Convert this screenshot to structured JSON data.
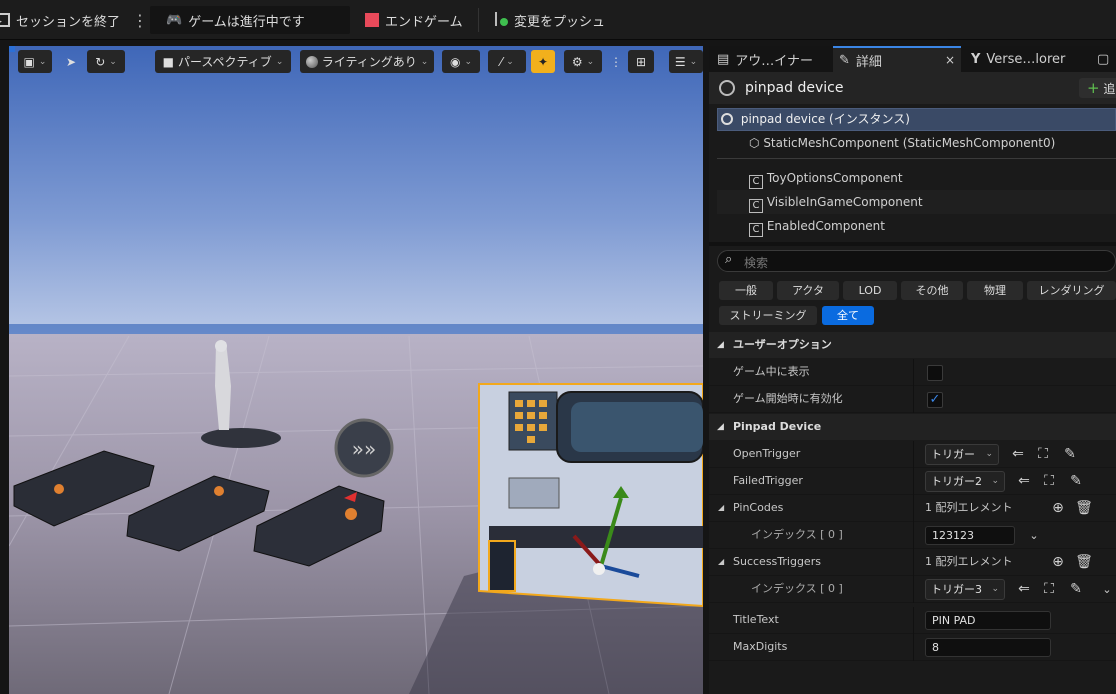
{
  "topbar": {
    "end_session": "セッションを終了",
    "game_running": "ゲームは進行中です",
    "end_game": "エンドゲーム",
    "push_changes": "変更をプッシュ"
  },
  "viewport": {
    "perspective": "パースペクティブ",
    "lighting": "ライティングあり"
  },
  "panel": {
    "tabs": [
      "アウ…イナー",
      "詳細",
      "Verse…lorer"
    ],
    "actor_name": "pinpad device",
    "add_label": "追",
    "instance_label": "pinpad device (インスタンス)",
    "components": [
      "StaticMeshComponent (StaticMeshComponent0)",
      "ToyOptionsComponent",
      "VisibleInGameComponent",
      "EnabledComponent"
    ],
    "search_placeholder": "検索",
    "filters": [
      "一般",
      "アクタ",
      "LOD",
      "その他",
      "物理",
      "レンダリング",
      "ストリーミング",
      "全て"
    ],
    "sections": {
      "user_options": "ユーザーオプション",
      "pinpad": "Pinpad Device"
    },
    "props": {
      "show_in_game": "ゲーム中に表示",
      "enable_at_start": "ゲーム開始時に有効化",
      "open_trigger": "OpenTrigger",
      "open_trigger_val": "トリガー",
      "failed_trigger": "FailedTrigger",
      "failed_trigger_val": "トリガー2",
      "pin_codes": "PinCodes",
      "pin_codes_count": "1 配列エレメント",
      "index0": "インデックス [ 0 ]",
      "pin_code_val": "123123",
      "success_triggers": "SuccessTriggers",
      "success_count": "1 配列エレメント",
      "success_val": "トリガー3",
      "title_text": "TitleText",
      "title_text_val": "PIN PAD",
      "max_digits": "MaxDigits",
      "max_digits_val": "8"
    }
  }
}
